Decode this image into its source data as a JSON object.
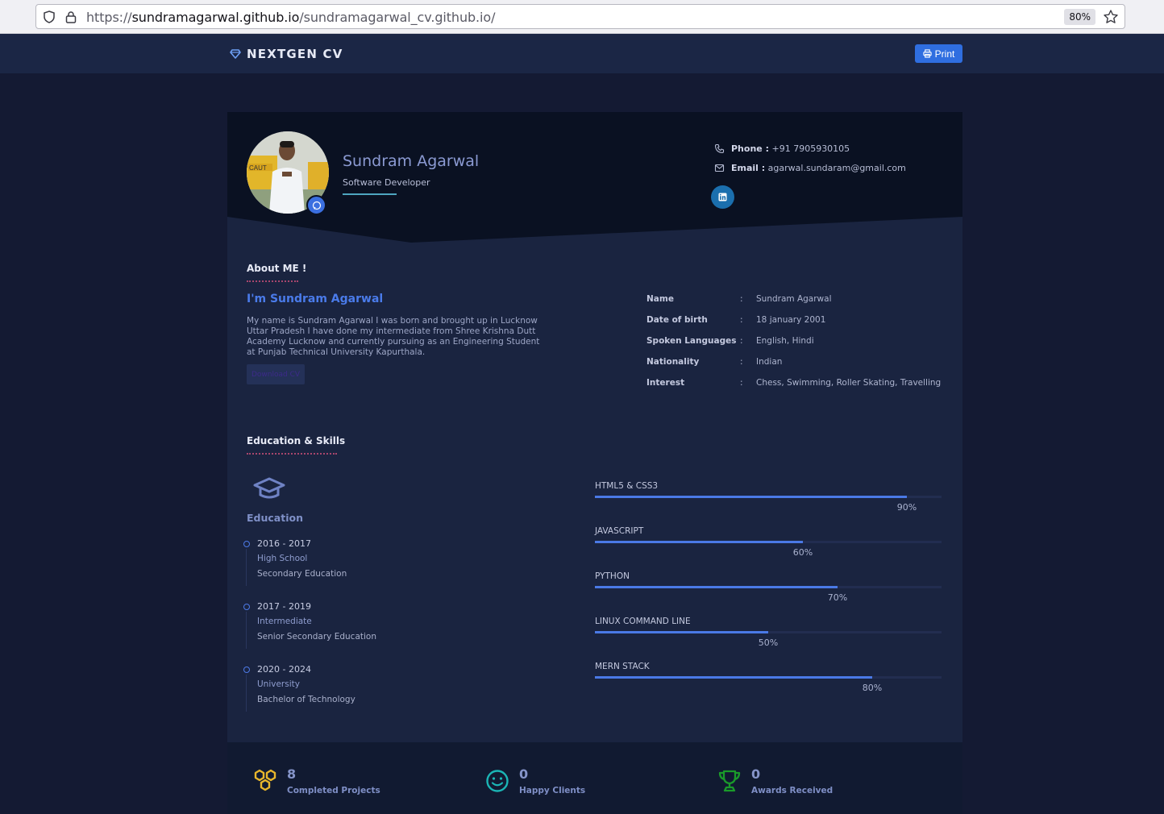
{
  "browser": {
    "url_prefix": "https://",
    "url_host": "sundramagarwal.github.io",
    "url_path": "/sundramagarwal_cv.github.io/",
    "zoom": "80%"
  },
  "navbar": {
    "brand": "NEXTGEN CV",
    "print_label": "Print"
  },
  "profile": {
    "name": "Sundram Agarwal",
    "role": "Software Developer",
    "phone_label": "Phone :",
    "phone": "+91 7905930105",
    "email_label": "Email :",
    "email": "agarwal.sundaram@gmail.com"
  },
  "about": {
    "title": "About ME !",
    "heading": "I'm Sundram Agarwal",
    "text": "My name is Sundram Agarwal I was born and brought up in Lucknow Uttar Pradesh I have done my intermediate from Shree Krishna Dutt Academy Lucknow and currently pursuing as an Engineering Student at Punjab Technical University Kapurthala.",
    "download_label": "Download CV"
  },
  "info": [
    {
      "key": "Name",
      "sep": ":",
      "value": "Sundram Agarwal"
    },
    {
      "key": "Date of birth",
      "sep": ":",
      "value": "18 january 2001"
    },
    {
      "key": "Spoken Languages",
      "sep": ":",
      "value": "English, Hindi"
    },
    {
      "key": "Nationality",
      "sep": ":",
      "value": "Indian"
    },
    {
      "key": "Interest",
      "sep": ":",
      "value": "Chess, Swimming, Roller Skating, Travelling"
    }
  ],
  "education": {
    "section_title": "Education & Skills",
    "title": "Education",
    "items": [
      {
        "years": "2016 - 2017",
        "level": "High School",
        "desc": "Secondary Education"
      },
      {
        "years": "2017 - 2019",
        "level": "Intermediate",
        "desc": "Senior Secondary Education"
      },
      {
        "years": "2020 - 2024",
        "level": "University",
        "desc": "Bachelor of Technology"
      }
    ]
  },
  "skills": [
    {
      "name": "HTML5 & CSS3",
      "percent": 90,
      "label": "90%"
    },
    {
      "name": "JAVASCRIPT",
      "percent": 60,
      "label": "60%"
    },
    {
      "name": "PYTHON",
      "percent": 70,
      "label": "70%"
    },
    {
      "name": "LINUX COMMAND LINE",
      "percent": 50,
      "label": "50%"
    },
    {
      "name": "MERN STACK",
      "percent": 80,
      "label": "80%"
    }
  ],
  "stats": [
    {
      "value": "8",
      "label": "Completed Projects",
      "icon": "hexagons-icon",
      "color": "#e8b62c"
    },
    {
      "value": "0",
      "label": "Happy Clients",
      "icon": "smile-icon",
      "color": "#1bb5b5"
    },
    {
      "value": "0",
      "label": "Awards Received",
      "icon": "trophy-icon",
      "color": "#1a9a2a"
    }
  ],
  "colors": {
    "accent": "#4a79e6",
    "page_bg": "#141a33",
    "card_bg": "#1a2440",
    "header_bg": "#0a1122"
  }
}
